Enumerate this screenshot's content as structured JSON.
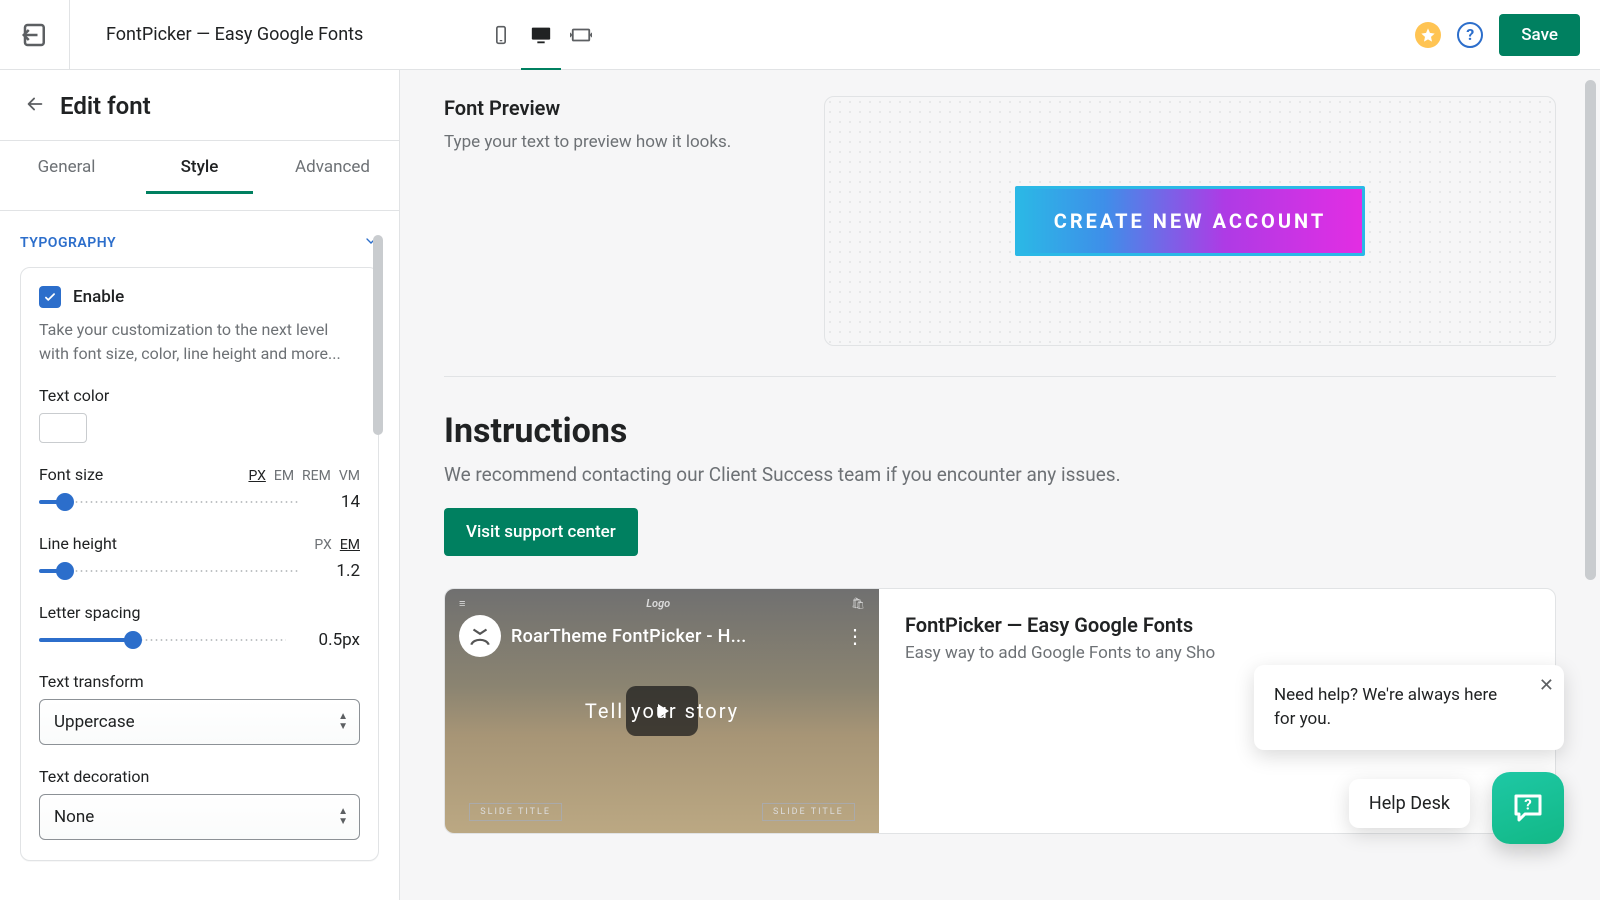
{
  "topbar": {
    "app_title": "FontPicker — Easy Google Fonts",
    "save_label": "Save"
  },
  "sidebar": {
    "title": "Edit font",
    "tabs": {
      "general": "General",
      "style": "Style",
      "advanced": "Advanced"
    },
    "section_title": "TYPOGRAPHY",
    "enable_label": "Enable",
    "enable_desc": "Take your customization to the next level with font size, color, line height and more...",
    "text_color_label": "Text color",
    "font_size_label": "Font size",
    "font_size_units": [
      "PX",
      "EM",
      "REM",
      "VM"
    ],
    "font_size_value": "14",
    "line_height_label": "Line height",
    "line_height_units": [
      "PX",
      "EM"
    ],
    "line_height_value": "1.2",
    "letter_spacing_label": "Letter spacing",
    "letter_spacing_value": "0.5px",
    "text_transform_label": "Text transform",
    "text_transform_value": "Uppercase",
    "text_decoration_label": "Text decoration",
    "text_decoration_value": "None"
  },
  "main": {
    "preview_title": "Font Preview",
    "preview_hint": "Type your text to preview how it looks.",
    "cta_label": "CREATE NEW ACCOUNT",
    "instructions_title": "Instructions",
    "instructions_sub": "We recommend contacting our Client Success team if you encounter any issues.",
    "visit_label": "Visit support center",
    "video_title": "FontPicker — Easy Google Fonts",
    "video_desc": "Easy way to add Google Fonts to any Sho",
    "yt_title": "RoarTheme FontPicker - H...",
    "yt_brand": "Logo",
    "story_text": "Tell your story",
    "slide_title": "SLIDE TITLE"
  },
  "help": {
    "bubble_text": "Need help? We're always here for you.",
    "pill_label": "Help Desk"
  },
  "colors": {
    "primary": "#008060",
    "link": "#2C6ECB",
    "star": "#FFC453",
    "fab_a": "#1EC8A5",
    "fab_b": "#12B886"
  }
}
